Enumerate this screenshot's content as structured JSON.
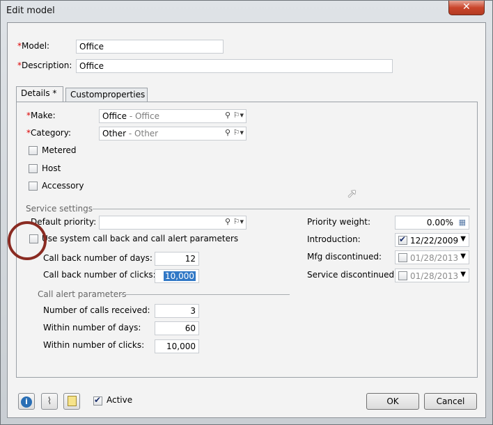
{
  "window": {
    "title": "Edit model"
  },
  "model": {
    "label": "Model:",
    "value": "Office"
  },
  "description": {
    "label": "Description:",
    "value": "Office"
  },
  "tabs": [
    {
      "label": "Details *"
    },
    {
      "label": "Customproperties"
    }
  ],
  "make": {
    "label": "Make:",
    "value": "Office",
    "desc": " - Office"
  },
  "category": {
    "label": "Category:",
    "value": "Other",
    "desc": " - Other"
  },
  "checkboxes": {
    "metered": "Metered",
    "host": "Host",
    "accessory": "Accessory"
  },
  "service": {
    "section_label": "Service settings",
    "default_priority_label": "Default priority:",
    "use_system_label": "Use system call back and call alert parameters",
    "callback_days_label": "Call back number of days:",
    "callback_days": "12",
    "callback_clicks_label": "Call back number of clicks:",
    "callback_clicks": "10,000",
    "alert_section_label": "Call alert parameters",
    "calls_received_label": "Number of calls received:",
    "calls_received": "3",
    "within_days_label": "Within number of days:",
    "within_days": "60",
    "within_clicks_label": "Within number of clicks:",
    "within_clicks": "10,000"
  },
  "right": {
    "priority_weight_label": "Priority weight:",
    "priority_weight": "0.00%",
    "introduction_label": "Introduction:",
    "introduction": "12/22/2009",
    "mfg_label": "Mfg discontinued:",
    "mfg": "01/28/2013",
    "service_disc_label": "Service discontinued:",
    "service_disc": "01/28/2013"
  },
  "bottom": {
    "active_label": "Active",
    "ok": "OK",
    "cancel": "Cancel"
  },
  "required_mark": "*",
  "icons": [
    "close-icon",
    "search-icon",
    "flag-dropdown-icon",
    "calendar-icon",
    "info-icon",
    "attachment-icon",
    "notes-icon"
  ],
  "colors": {
    "accent": "#3178c6",
    "required": "#dd0000",
    "close": "#c9462c"
  }
}
